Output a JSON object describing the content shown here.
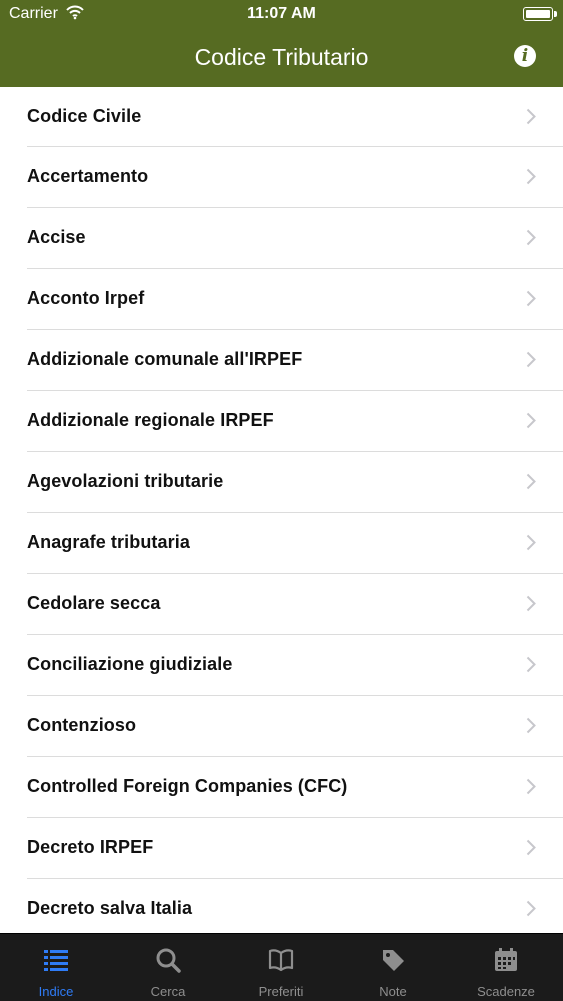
{
  "status": {
    "carrier": "Carrier",
    "time": "11:07 AM"
  },
  "nav": {
    "title": "Codice Tributario",
    "info_label": "i"
  },
  "items": [
    "Codice Civile",
    "Accertamento",
    "Accise",
    "Acconto Irpef",
    "Addizionale comunale all'IRPEF",
    "Addizionale regionale IRPEF",
    "Agevolazioni tributarie",
    "Anagrafe tributaria",
    "Cedolare secca",
    "Conciliazione giudiziale",
    "Contenzioso",
    "Controlled Foreign Companies (CFC)",
    "Decreto IRPEF",
    "Decreto salva Italia"
  ],
  "tabs": [
    {
      "label": "Indice",
      "icon": "list-icon",
      "active": true
    },
    {
      "label": "Cerca",
      "icon": "search-icon",
      "active": false
    },
    {
      "label": "Preferiti",
      "icon": "book-icon",
      "active": false
    },
    {
      "label": "Note",
      "icon": "tag-icon",
      "active": false
    },
    {
      "label": "Scadenze",
      "icon": "calendar-icon",
      "active": false
    }
  ],
  "colors": {
    "navbar": "#566b22",
    "tabbar": "#1b1b1b",
    "active_tab": "#2f7cf6"
  }
}
